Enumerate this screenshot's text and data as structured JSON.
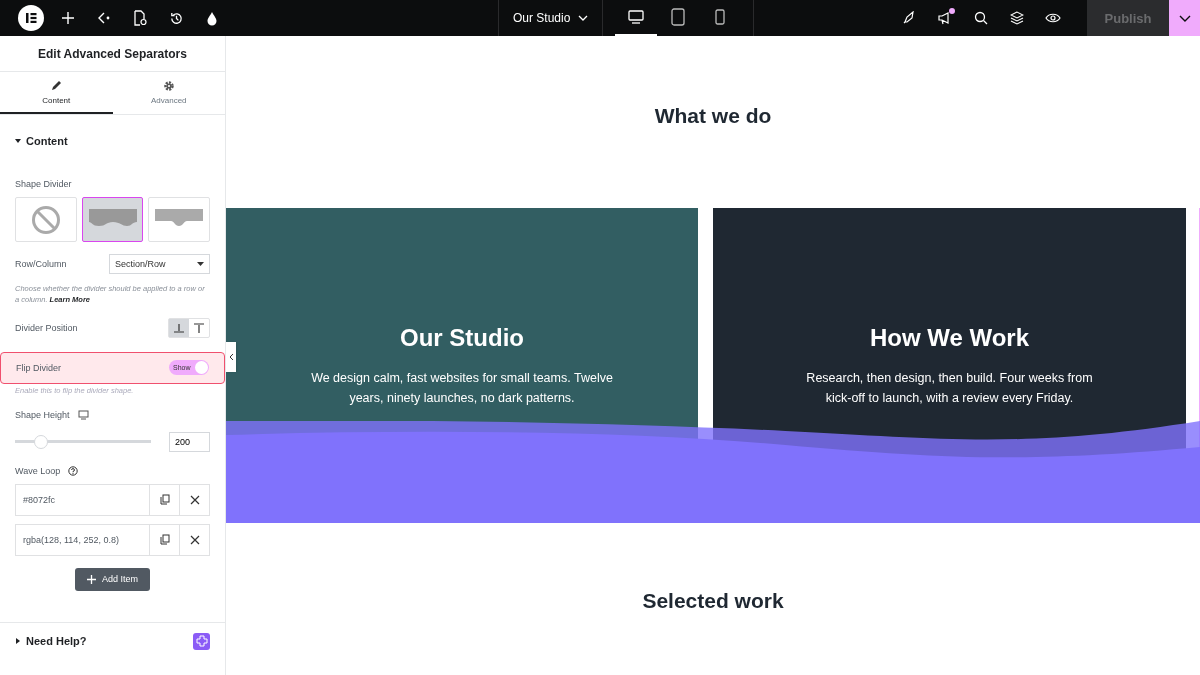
{
  "top_bar": {
    "document_title": "Our Studio",
    "devices": [
      {
        "kind": "desktop",
        "selected": true
      },
      {
        "kind": "tablet",
        "selected": false
      },
      {
        "kind": "mobile",
        "selected": false
      }
    ],
    "notification": true,
    "publish": "Publish"
  },
  "panel": {
    "title": "Edit Advanced Separators",
    "tabs": [
      {
        "label": "Content",
        "kind": "pencil",
        "selected": true
      },
      {
        "label": "Advanced",
        "kind": "gear",
        "selected": false
      }
    ],
    "section": {
      "label": "Content",
      "expanded": true
    },
    "shape_divider": {
      "label": "Shape Divider",
      "options": [
        {
          "kind": "none",
          "selected": false
        },
        {
          "kind": "waves",
          "selected": true
        },
        {
          "kind": "curve",
          "selected": false
        }
      ]
    },
    "row_column": {
      "label": "Row/Column",
      "value": "Section/Row",
      "help": "Choose whether the divider should be applied to a row or a column.",
      "link": "Learn More"
    },
    "divider_position": {
      "label": "Divider Position",
      "options": [
        {
          "kind": "bottom",
          "selected": true
        },
        {
          "kind": "top",
          "selected": false
        }
      ]
    },
    "flip_divider": {
      "label": "Flip Divider",
      "switch_label": "Show",
      "on": true,
      "highlighted": true,
      "hint": "Enable this to flip the divider shape."
    },
    "shape_height": {
      "label": "Shape Height",
      "level": 0.19,
      "value": "200"
    },
    "wave_loop": {
      "label": "Wave Loop",
      "items": [
        {
          "value": "#8072fc"
        },
        {
          "value": "rgba(128, 114, 252, 0.8)"
        }
      ],
      "add_button": "Add Item"
    },
    "need_help": {
      "label": "Need Help?",
      "expanded": false
    }
  },
  "canvas": {
    "heading": "What we do",
    "cards": [
      {
        "title": "Our Studio",
        "text": "We design calm, fast websites for small teams. Twelve years, ninety launches, no dark patterns.",
        "color": "#325e62"
      },
      {
        "title": "How We Work",
        "text": "Research, then design, then build. Four weeks from kick-off to launch, with a review every Friday.",
        "color": "#1f2832"
      }
    ],
    "heading_2": "Selected work"
  }
}
